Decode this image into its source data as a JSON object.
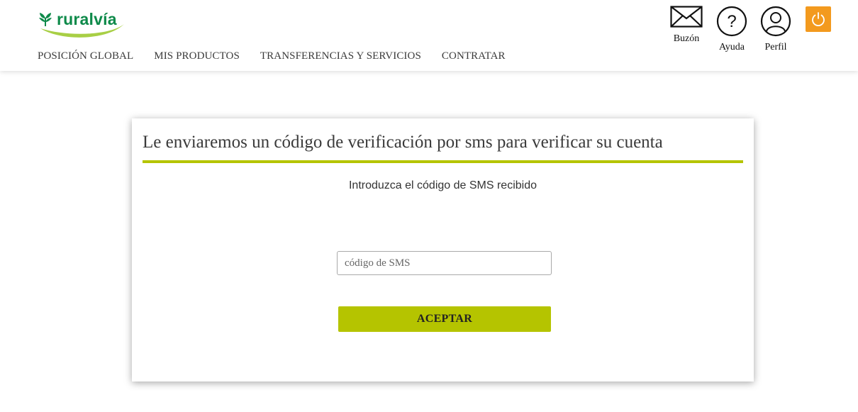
{
  "brand": {
    "logo_text": "ruralvía",
    "logo_color": "#0e8a4a",
    "swoosh_color": "#a8cf45"
  },
  "nav": {
    "items": [
      {
        "label": "POSICIÓN GLOBAL"
      },
      {
        "label": "MIS PRODUCTOS"
      },
      {
        "label": "TRANSFERENCIAS Y SERVICIOS"
      },
      {
        "label": "CONTRATAR"
      }
    ]
  },
  "utilities": {
    "buzon": {
      "label": "Buzón",
      "icon": "envelope-icon"
    },
    "ayuda": {
      "label": "Ayuda",
      "icon": "question-icon"
    },
    "perfil": {
      "label": "Perfil",
      "icon": "user-icon"
    },
    "logout": {
      "icon": "power-icon",
      "color": "#f39a1e"
    }
  },
  "verification": {
    "title": "Le enviaremos un código de verificación por sms para verificar su cuenta",
    "instruction": "Introduzca el código de SMS recibido",
    "input_placeholder": "código de SMS",
    "input_value": "",
    "accept_label": "ACEPTAR",
    "accent_color": "#b5c400"
  }
}
